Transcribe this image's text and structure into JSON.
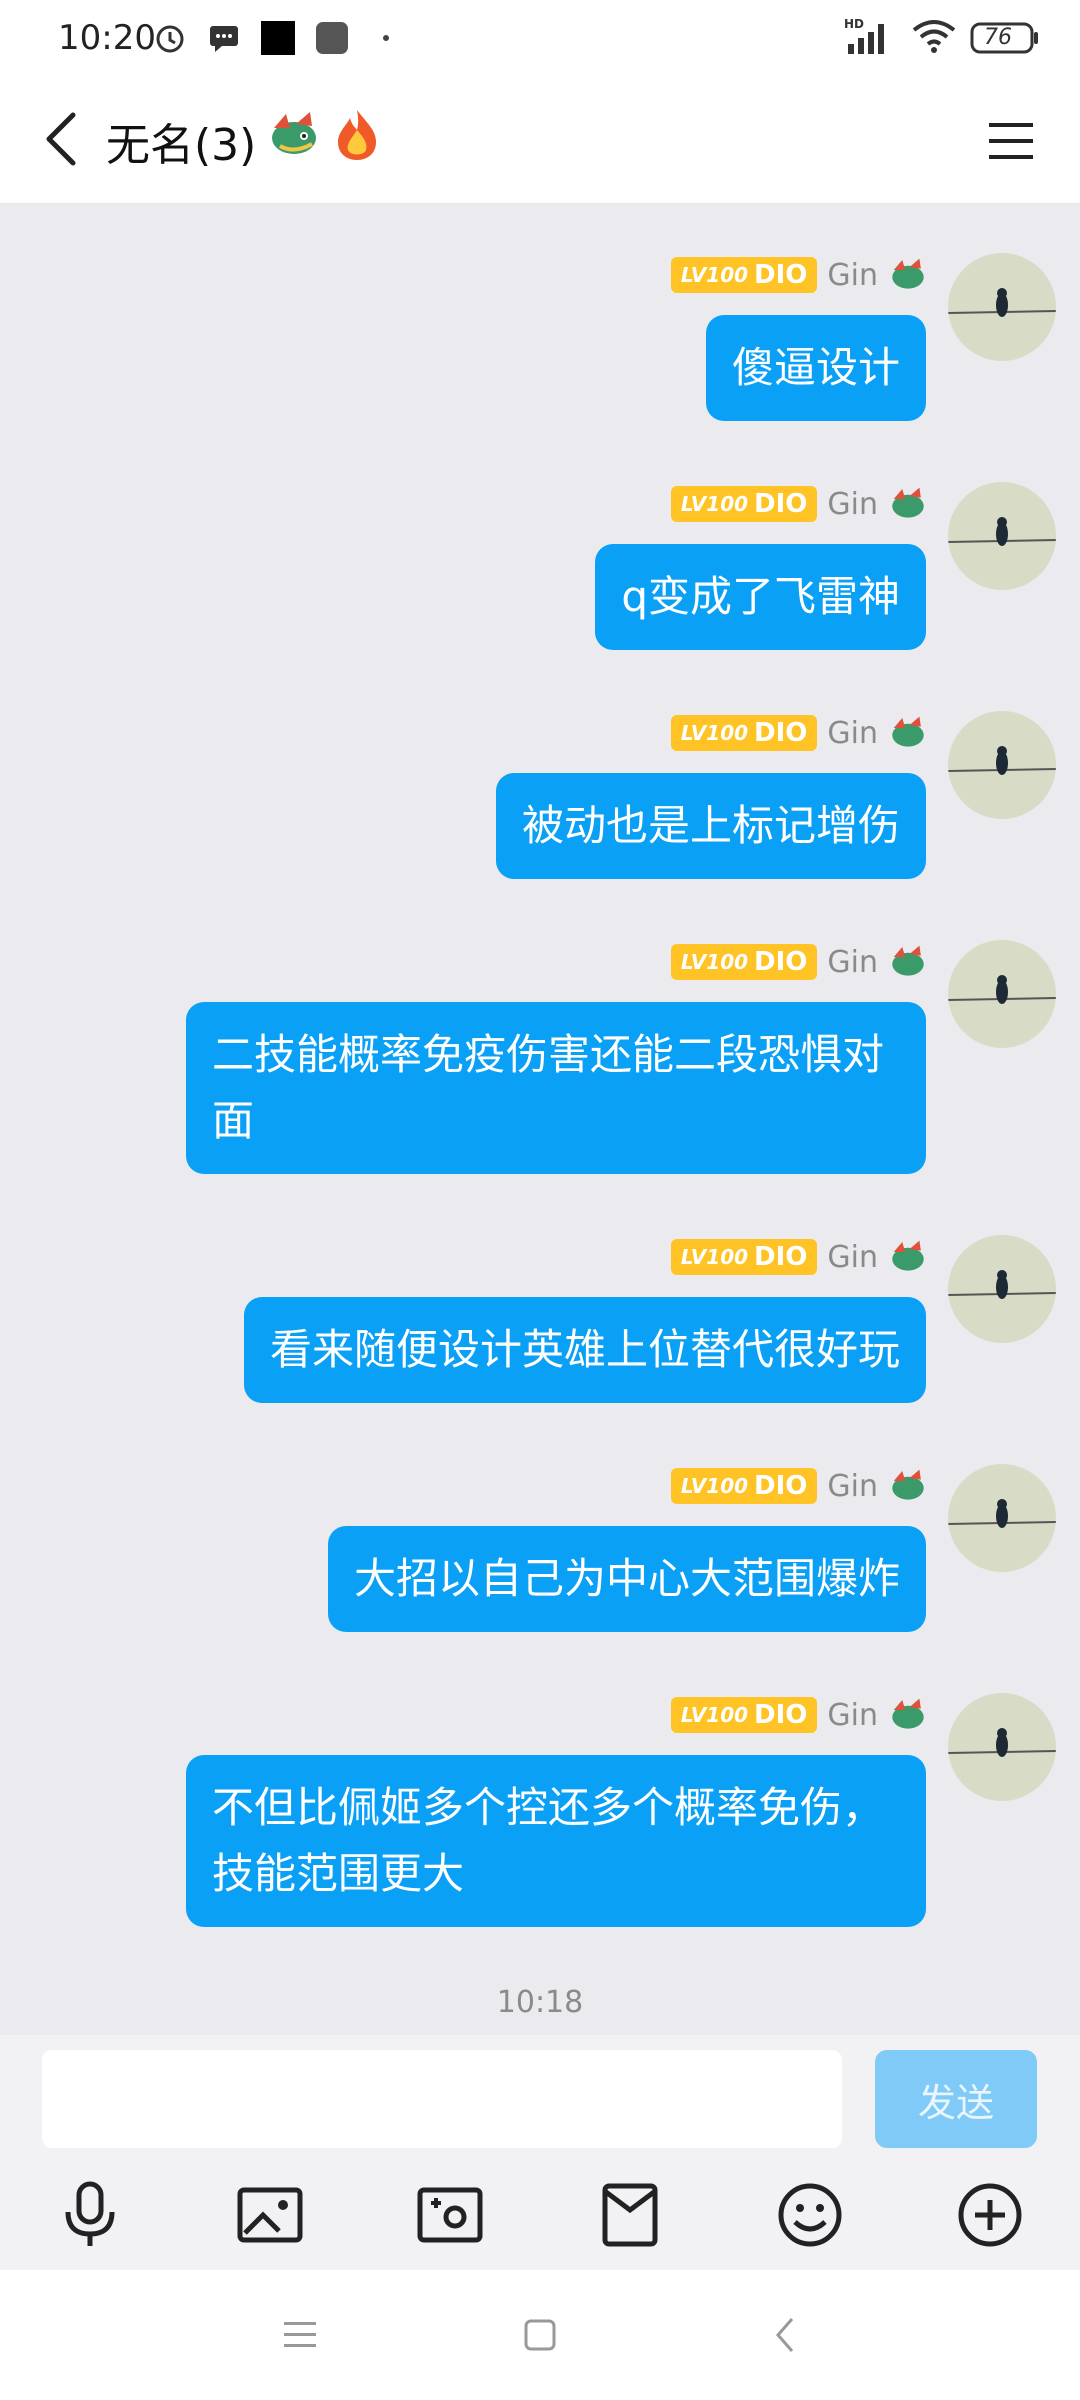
{
  "status_bar": {
    "time": "10:20",
    "battery": "76",
    "network": "HD"
  },
  "header": {
    "title": "无名(3)"
  },
  "sender": {
    "name": "Gin",
    "badge_level": "LV100",
    "badge_name": "DIO"
  },
  "messages": [
    {
      "text": "傻逼设计"
    },
    {
      "text": "q变成了飞雷神"
    },
    {
      "text": "被动也是上标记增伤"
    },
    {
      "text": "二技能概率免疫伤害还能二段恐惧对面"
    },
    {
      "text": "看来随便设计英雄上位替代很好玩"
    },
    {
      "text": "大招以自己为中心大范围爆炸"
    },
    {
      "text": "不但比佩姬多个控还多个概率免伤，技能范围更大"
    }
  ],
  "timestamp": "10:18",
  "input": {
    "placeholder": "",
    "send_label": "发送"
  },
  "toolbar": {
    "icons": [
      "microphone-icon",
      "image-icon",
      "camera-icon",
      "red-packet-icon",
      "emoji-icon",
      "plus-icon"
    ]
  },
  "colors": {
    "bubble": "#0aa0f6",
    "badge": "#ffc325",
    "send_disabled": "#7fcaf7",
    "background": "#ebebef"
  }
}
